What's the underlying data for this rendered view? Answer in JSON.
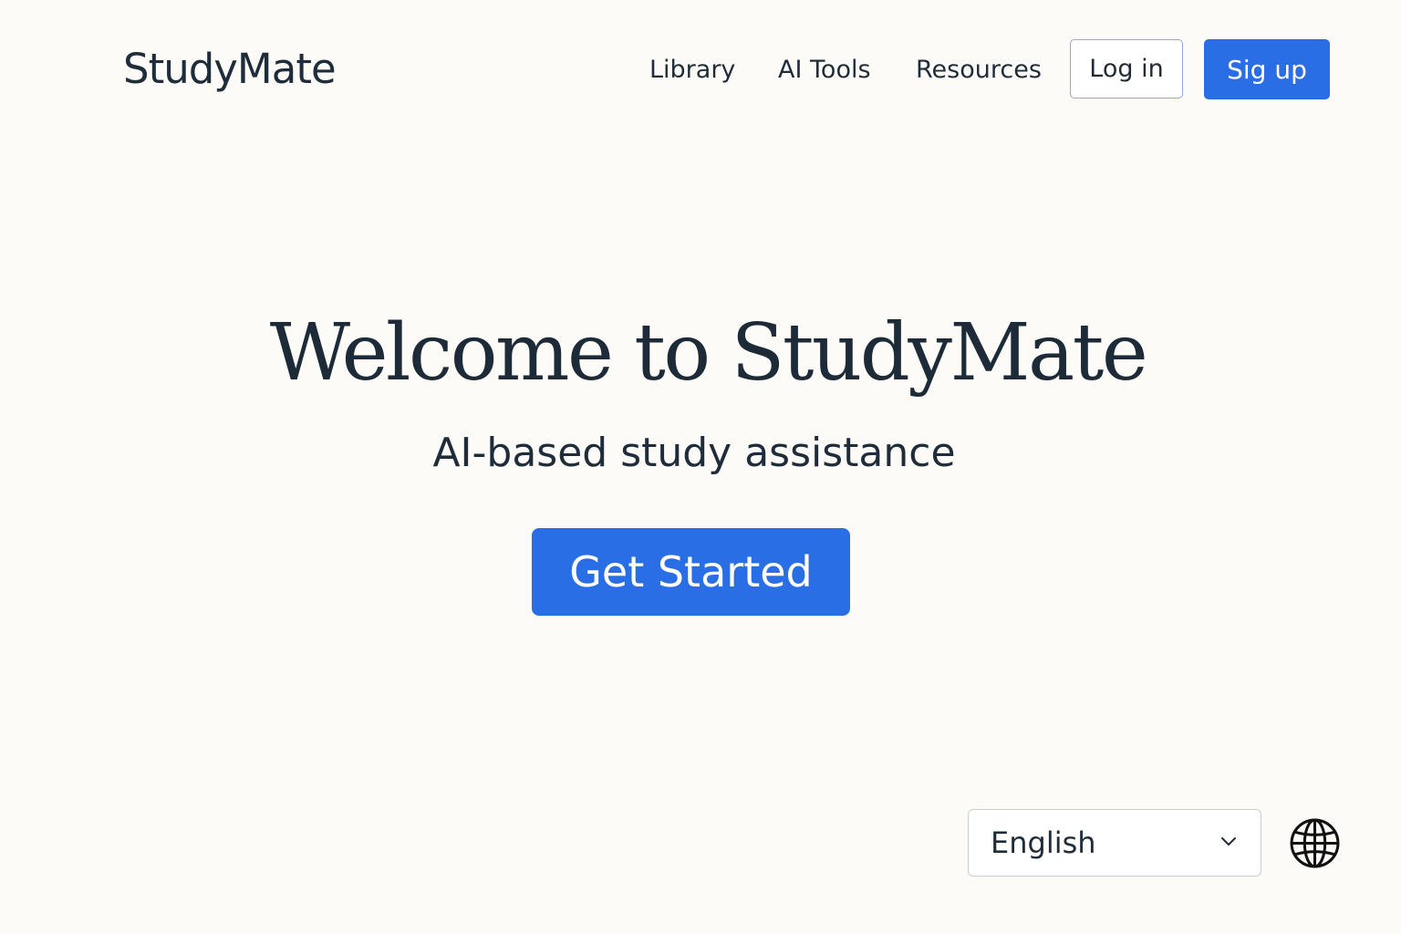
{
  "header": {
    "logo": "StudyMate",
    "nav": {
      "library": "Library",
      "ai_tools": "AI Tools",
      "resources": "Resources"
    },
    "login_label": "Log in",
    "signup_label": "Sig up"
  },
  "hero": {
    "title": "Welcome to StudyMate",
    "subtitle": "AI-based study assistance",
    "cta_label": "Get Started"
  },
  "footer": {
    "language": {
      "selected": "English",
      "chevron_icon": "chevron-down-icon",
      "globe_icon": "globe-icon"
    }
  },
  "colors": {
    "background": "#fcfbf8",
    "text": "#1f2d3a",
    "accent": "#2a6ee6",
    "outline_button_border": "#8ea9e8"
  }
}
